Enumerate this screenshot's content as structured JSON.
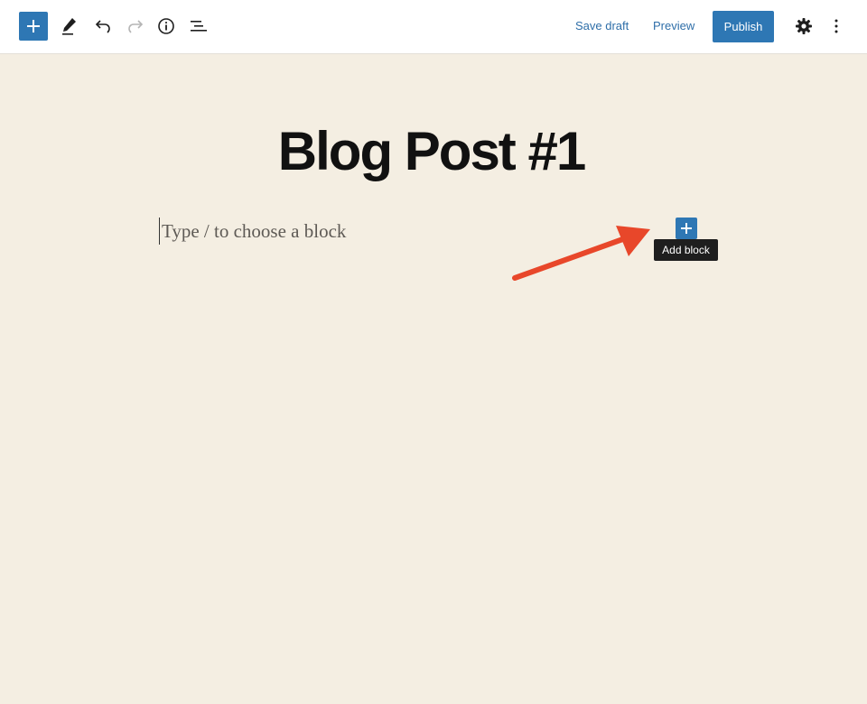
{
  "toolbar": {
    "save_draft_label": "Save draft",
    "preview_label": "Preview",
    "publish_label": "Publish",
    "icons": {
      "inserter": "plus-icon",
      "tools": "pencil-icon",
      "undo": "undo-icon",
      "redo": "redo-icon",
      "details": "info-icon",
      "outline": "list-view-icon",
      "settings": "gear-icon",
      "options": "more-vertical-icon"
    }
  },
  "editor": {
    "post_title": "Blog Post #1",
    "block_placeholder": "Type / to choose a block",
    "add_block_tooltip": "Add block"
  },
  "colors": {
    "accent": "#2e77b4",
    "canvas_background": "#f4eee2",
    "annotation_arrow": "#e8472a",
    "tooltip_background": "#1e1e1e"
  }
}
